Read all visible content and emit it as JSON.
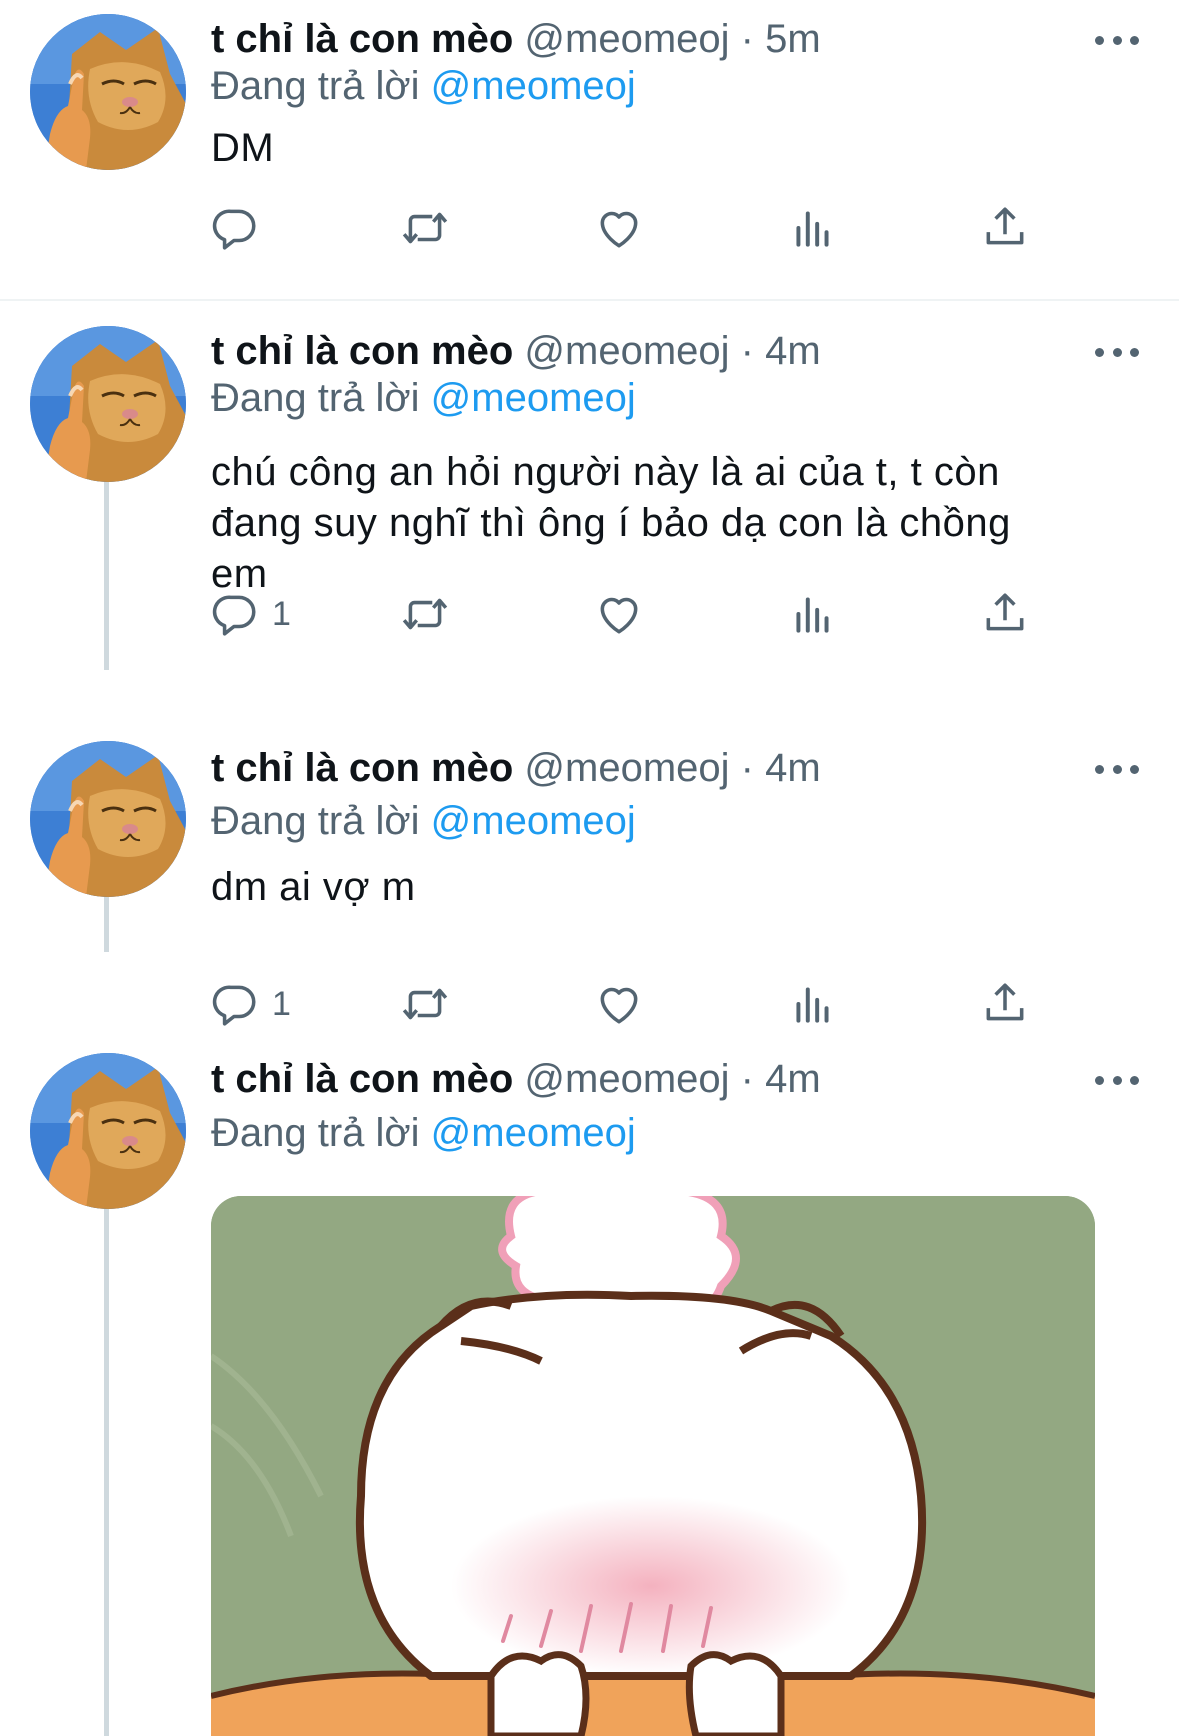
{
  "tweets": [
    {
      "display_name": "t chỉ là con mèo",
      "handle": "@meomeoj",
      "time": "5m",
      "reply_prefix": "Đang trả lời",
      "reply_to": "@meomeoj",
      "text": "DM",
      "reply_count": ""
    },
    {
      "display_name": "t chỉ là con mèo",
      "handle": "@meomeoj",
      "time": "4m",
      "reply_prefix": "Đang trả lời",
      "reply_to": "@meomeoj",
      "text_lines": [
        "chú công an hỏi người này là ai của t, t còn",
        "đang suy nghĩ thì ông í bảo dạ con là chồng",
        "em"
      ],
      "reply_count": "1"
    },
    {
      "display_name": "t chỉ là con mèo",
      "handle": "@meomeoj",
      "time": "4m",
      "reply_prefix": "Đang trả lời",
      "reply_to": "@meomeoj",
      "text": "dm ai vợ m",
      "reply_count": "1"
    },
    {
      "display_name": "t chỉ là con mèo",
      "handle": "@meomeoj",
      "time": "4m",
      "reply_prefix": "Đang trả lời",
      "reply_to": "@meomeoj",
      "media": "cat-cartoon-image"
    }
  ],
  "separator": "·",
  "icons": {
    "reply": "reply-icon",
    "retweet": "retweet-icon",
    "like": "heart-icon",
    "views": "views-icon",
    "share": "share-icon",
    "more": "more-icon"
  },
  "colors": {
    "text": "#0f1419",
    "secondary": "#536471",
    "link": "#1d9bf0",
    "thread_line": "#cfd9de",
    "media_background": "#93a882"
  }
}
